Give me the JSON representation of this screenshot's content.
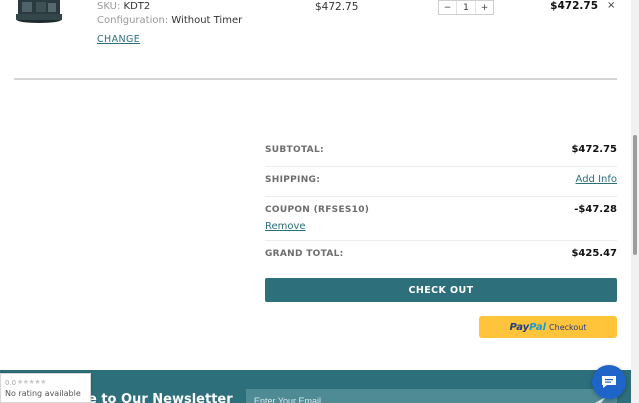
{
  "cart_item": {
    "sku_label": "SKU:",
    "sku_value": "KDT2",
    "config_label": "Configuration:",
    "config_value": "Without Timer",
    "change_label": "CHANGE",
    "unit_price": "$472.75",
    "quantity": "1",
    "qty_minus": "−",
    "qty_plus": "+",
    "line_total": "$472.75",
    "remove_icon": "×"
  },
  "totals": {
    "subtotal_label": "SUBTOTAL:",
    "subtotal_value": "$472.75",
    "shipping_label": "SHIPPING:",
    "shipping_link": "Add Info",
    "coupon_label": "COUPON (RFSES10)",
    "coupon_value": "-$47.28",
    "coupon_remove": "Remove",
    "grand_label": "GRAND TOTAL:",
    "grand_value": "$425.47"
  },
  "buttons": {
    "checkout": "CHECK OUT",
    "paypal_pay": "Pay",
    "paypal_pal": "Pal",
    "paypal_checkout": "Checkout"
  },
  "newsletter": {
    "title": "e to Our Newsletter",
    "email_placeholder": "Enter Your Email"
  },
  "rating_badge": {
    "score": "0.0",
    "stars": "★★★★★",
    "text": "No rating available"
  },
  "colors": {
    "accent": "#2d6f7b",
    "paypal_yellow": "#ffc439",
    "chat_blue": "#1f64c8"
  },
  "icons": [
    "product-image",
    "close-icon",
    "send-icon",
    "chat-icon"
  ]
}
